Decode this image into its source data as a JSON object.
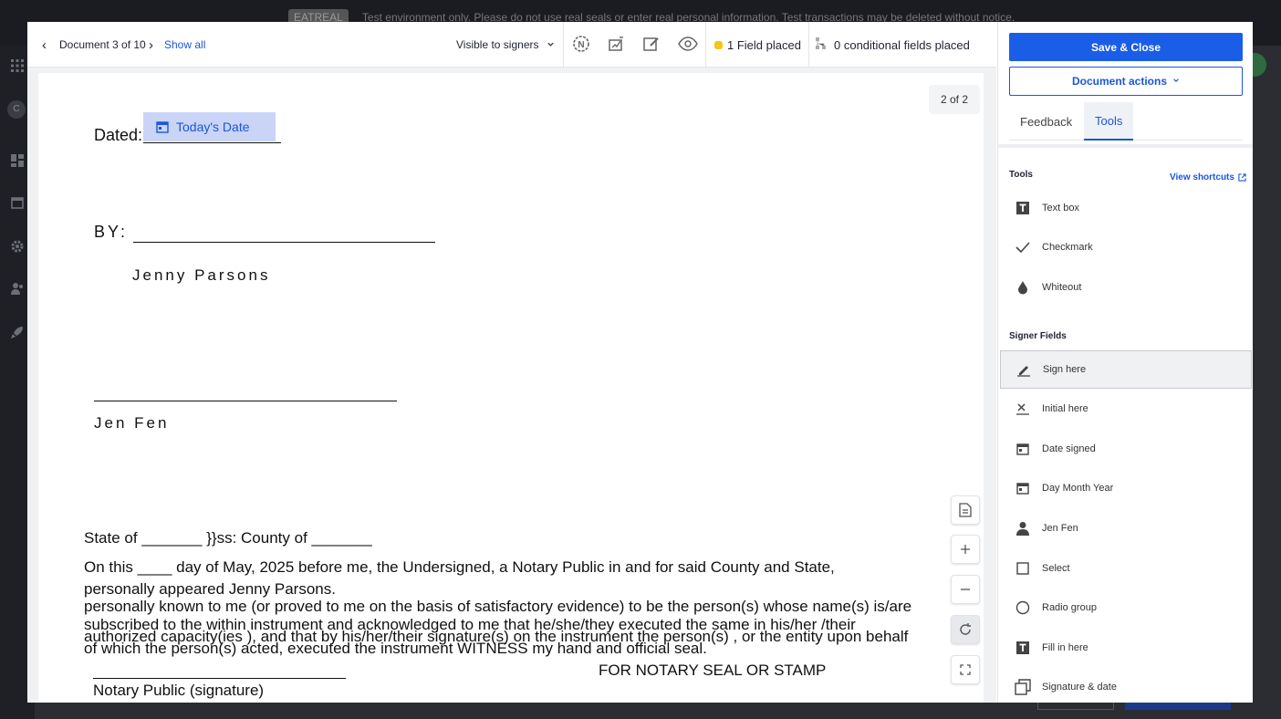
{
  "background": {
    "pill_label": "EATREAL",
    "banner_text": "Test environment only. Please do not use real seals or enter real personal information. Test transactions may be deleted without notice."
  },
  "toolbar": {
    "prev_label": "‹",
    "doc_position": "Document 3 of 10",
    "next_label": "›",
    "show_all": "Show all",
    "visibility": "Visible to signers",
    "fields_placed": "1 Field placed",
    "conditional_fields": "0 conditional fields placed"
  },
  "page": {
    "counter": "2 of 2",
    "date_field_label": "Today's Date",
    "dated_label": "Dated:",
    "by_label": "BY:",
    "signer_name_1": "Jenny Parsons",
    "signer_name_2": "Jen Fen",
    "state_line": "State of _______ }}ss: County of _______",
    "notary_line1": "On this ____ day of May, 2025 before me, the Undersigned, a Notary Public in and for said County and State,",
    "notary_line2": "personally appeared Jenny Parsons.",
    "notary_line3": "personally known to me (or proved to me on the basis of satisfactory evidence) to be the person(s) whose name(s) is/are",
    "notary_line4": "subscribed to the within instrument and acknowledged to me that he/she/they executed the same in his/her /their",
    "notary_line5": "authorized  capacity(ies ), and that by his/her/their signature(s) on the instrument the person(s) , or the entity upon behalf",
    "notary_line6": "of which the person(s) acted, executed the instrument WITNESS my hand and official seal.",
    "seal_label": "FOR NOTARY SEAL OR STAMP",
    "notary_signature_label": "Notary Public (signature)"
  },
  "panel": {
    "save_close": "Save & Close",
    "document_actions": "Document actions",
    "tabs": [
      {
        "label": "Feedback",
        "active": false
      },
      {
        "label": "Tools",
        "active": true
      }
    ],
    "tools_title": "Tools",
    "view_shortcuts": "View shortcuts",
    "tools": [
      {
        "label": "Text box",
        "icon": "text-box-icon"
      },
      {
        "label": "Checkmark",
        "icon": "checkmark-icon"
      },
      {
        "label": "Whiteout",
        "icon": "whiteout-drop-icon"
      }
    ],
    "signer_fields_title": "Signer Fields",
    "signer_fields": [
      {
        "label": "Sign here",
        "icon": "pen-sign-icon",
        "selected": true
      },
      {
        "label": "Initial here",
        "icon": "initial-x-icon"
      },
      {
        "label": "Date signed",
        "icon": "calendar-icon"
      },
      {
        "label": "Day Month Year",
        "icon": "calendar-icon"
      },
      {
        "label": "Jen Fen",
        "icon": "person-icon"
      },
      {
        "label": "Select",
        "icon": "checkbox-icon"
      },
      {
        "label": "Radio group",
        "icon": "radio-icon"
      },
      {
        "label": "Fill in here",
        "icon": "text-box-icon"
      },
      {
        "label": "Signature & date",
        "icon": "signature-date-icon"
      }
    ]
  },
  "colors": {
    "accent": "#1a5ee8",
    "date_field_bg": "#c9d4f7",
    "field_dot": "#f5c518"
  }
}
